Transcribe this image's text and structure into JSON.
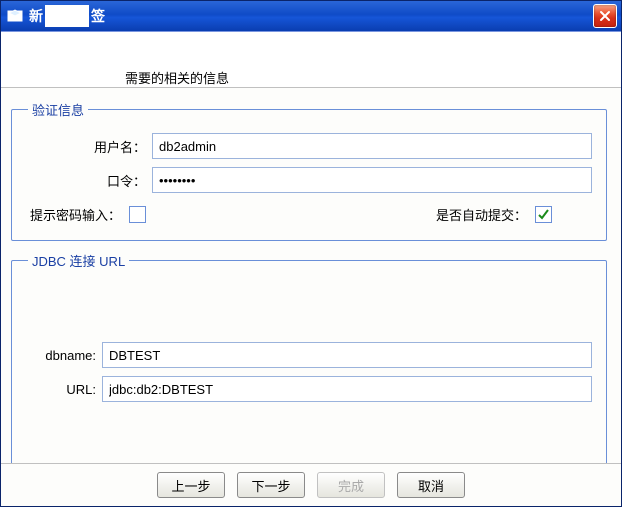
{
  "title": {
    "frag1": "新",
    "frag2": "签"
  },
  "banner": {
    "frag": "",
    "sub": "需要的相关的信息"
  },
  "auth": {
    "legend": "验证信息",
    "username_label": "用户名：",
    "username_value": "db2admin",
    "password_label": "口令：",
    "password_value": "••••••••",
    "prompt_pw_label": "提示密码输入：",
    "prompt_pw_checked": false,
    "auto_commit_label": "是否自动提交：",
    "auto_commit_checked": true
  },
  "jdbc": {
    "legend": "JDBC 连接 URL",
    "dbname_label": "dbname:",
    "dbname_value": "DBTEST",
    "url_label": "URL:",
    "url_value": "jdbc:db2:DBTEST"
  },
  "buttons": {
    "back": "上一步",
    "next": "下一步",
    "finish": "完成",
    "cancel": "取消"
  }
}
